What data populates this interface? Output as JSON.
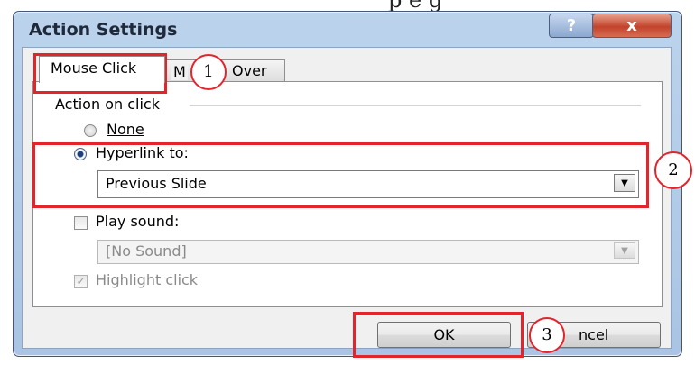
{
  "top_overflow_text": "p e  g",
  "window": {
    "title": "Action Settings",
    "help_label": "?",
    "close_label": "x"
  },
  "tabs": [
    {
      "label": "Mouse Click",
      "active": true
    },
    {
      "label": "Over",
      "visible_fragment_prefix": "M"
    }
  ],
  "group": {
    "label": "Action on click",
    "options": {
      "none": {
        "label": "None",
        "selected": false
      },
      "hyperlink": {
        "label": "Hyperlink to:",
        "selected": true,
        "value": "Previous Slide"
      }
    },
    "play_sound": {
      "label": "Play sound:",
      "checked": false,
      "enabled": false,
      "value": "[No Sound]"
    },
    "highlight_click": {
      "label": "Highlight click",
      "checked": true,
      "enabled": false
    }
  },
  "buttons": {
    "ok_label": "OK",
    "cancel_fragment": "ncel"
  },
  "annotations": {
    "callout_1": "1",
    "callout_2": "2",
    "callout_3": "3",
    "highlight_color": "#e3242b"
  }
}
